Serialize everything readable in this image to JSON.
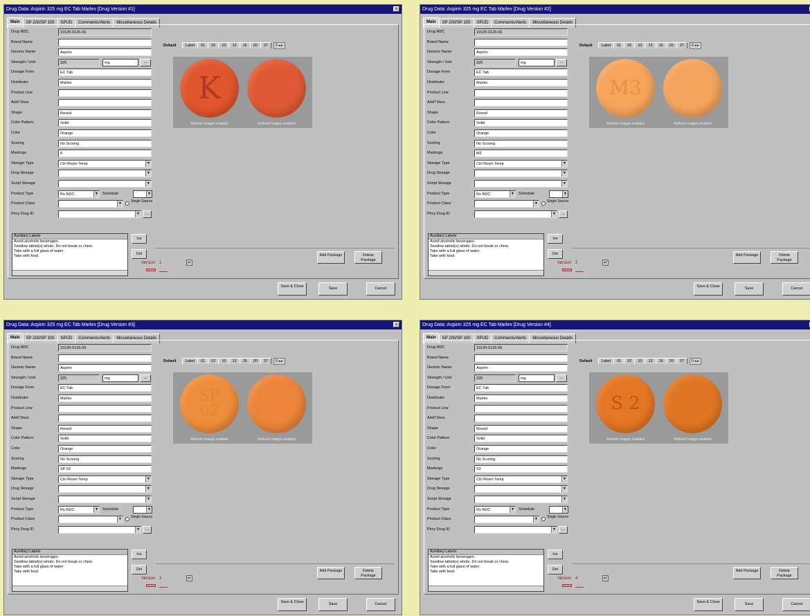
{
  "windows": [
    {
      "title": "Drug Data: Aspirin 325 mg EC Tab Marlex   [Drug Version #1]",
      "imprint_lines": [
        "K"
      ],
      "imprint_color": "#b03a20",
      "pill_color": "#e0562e",
      "back_color": "#df5a34",
      "markings": "K",
      "version": "1"
    },
    {
      "title": "Drug Data: Aspirin 325 mg EC Tab Marlex   [Drug Version #2]",
      "imprint_lines": [
        "M3"
      ],
      "imprint_color": "#e2914a",
      "pill_color": "#f7a55c",
      "back_color": "#f4a45c",
      "markings": "M3",
      "version": "2"
    },
    {
      "title": "Drug Data: Aspirin 325 mg EC Tab Marlex   [Drug Version #3]",
      "imprint_lines": [
        "SP",
        "02"
      ],
      "imprint_color": "#dd8838",
      "pill_color": "#ee8d3c",
      "back_color": "#ec853a",
      "markings": "SP 02",
      "version": "3"
    },
    {
      "title": "Drug Data: Aspirin 325 mg EC Tab Marlex   [Drug Version #4]",
      "imprint_lines": [
        "S 2"
      ],
      "imprint_color": "#b85a14",
      "pill_color": "#e47624",
      "back_color": "#e17622",
      "markings": "S2",
      "version": "4"
    }
  ],
  "tabs": [
    "Main",
    "SP 200/SP 100",
    "SPUD",
    "Comments/Alerts",
    "Miscellaneous Details"
  ],
  "fields": {
    "drug_ndc_label": "Drug NDC",
    "drug_ndc": "10135-0126-06",
    "brand_name_label": "Brand Name",
    "generic_name_label": "Generic Name",
    "generic_name": "Aspirin",
    "strength_label": "Strength / Unit",
    "strength": "325",
    "unit": "mg",
    "dosage_form_label": "Dosage Form",
    "dosage_form": "EC Tab",
    "distributor_label": "Distributor",
    "distributor": "Marlex",
    "product_line_label": "Product Line",
    "addl_desc_label": "Add'l Desc",
    "shape_label": "Shape",
    "shape": "Round",
    "color_pattern_label": "Color Pattern",
    "color_pattern": "Solid",
    "color_label": "Color",
    "color": "Orange",
    "scoring_label": "Scoring",
    "scoring": "No Scoring",
    "markings_label": "Markings",
    "storage_type_label": "Storage Type",
    "storage_type": "Ctrl Room Temp",
    "drug_storage_label": "Drug Storage",
    "script_storage_label": "Script Storage",
    "product_type_label": "Product Type",
    "product_type": "Rx-NDC",
    "schedule_label": "Schedule",
    "product_class_label": "Product Class",
    "single_source_label": "Single Source",
    "phcy_drug_id_label": "Phcy Drug ID",
    "dots": "...",
    "dropdown_arrow": "▼"
  },
  "aux": {
    "header": "Auxiliary Labels",
    "lines": [
      "Avoid alcoholic beverages.",
      "Swallow tablet(s) whole. Do not break or chew.",
      "Take with a full glass of water",
      "Take with food."
    ],
    "ins": "Ins",
    "del": "Del"
  },
  "package": {
    "tabs": [
      "Default",
      "Label",
      "01",
      "02",
      "10",
      "13",
      "16",
      "20",
      "27"
    ],
    "spinner": "0 ◂ ▸",
    "front_caption": "Refresh images enabled",
    "back_caption": "Refresh images enabled",
    "add": "Add Package",
    "delete": "Delete Package"
  },
  "version_label": "Version",
  "version_icon": "↵",
  "buttons": {
    "save_close": "Save & Close",
    "save": "Save",
    "cancel": "Cancel"
  }
}
